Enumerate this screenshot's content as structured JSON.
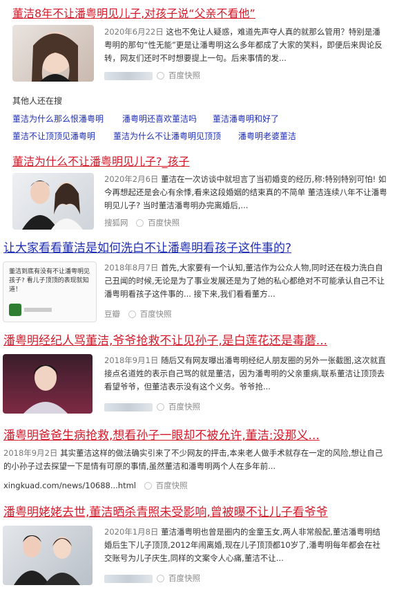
{
  "results": [
    {
      "title": "董洁8年不让潘粤明见儿子,对孩子说“父亲不看他”",
      "date": "2020年6月22日",
      "snippet": "这也不免让人疑惑，难道先声夺人真的就那么管用？特别是潘粤明的那句“性无能”更是让潘粤明这么多年都成了大家的笑料，即便后来舆论反转，网友们还时不时想要提上一句。后来事情的发...",
      "source": "百度快照"
    },
    {
      "title": "董洁为什么不让潘粤明见儿子?_孩子",
      "date": "2020年2月6日",
      "snippet": "董洁在一次访谈中就坦言了当初婚变的经历,称:特别特别可怕! 如今再想起还是会心有余悸,看来这段婚姻的结束真的不简单 董洁连续八年不让潘粤明见儿子? 当时董洁潘粤明办完离婚后,...",
      "site": "搜狐网",
      "source": "百度快照"
    },
    {
      "title": "让大家看看董洁是如何洗白不让潘粤明看孩子这件事的?",
      "thumb_text": "董洁到底有没有不让潘粤明见孩子? 看儿子顶顶的表现就知道！",
      "date": "2018年8月7日",
      "snippet": "首先,大家要有一个认知,董洁作为公众人物,同时还在极力洗白自己丑闻的时候,无论是为了事业发展还是为了她的私心都绝对不可能承认自己不让潘粤明看孩子这件事的... 接下来,我们看看董方...",
      "site": "豆瓣",
      "source": "百度快照"
    },
    {
      "title": "潘粤明经纪人骂董洁,爷爷抢救不让见孙子,是白莲花还是毒蘑...",
      "date": "2018年9月1日",
      "snippet": "随后又有网友曝出潘粤明经纪人朋友圈的另外一张截图,这次就直接点名道姓的表示自己骂的就是董洁，因为潘粤明的父亲重病,联系董洁让顶顶去看望爷爷，但董洁表示没有这个义务。爷爷抢...",
      "source": "百度快照"
    },
    {
      "title": "潘粤明爸爸生病抢救,想看孙子一眼却不被允许,董洁:没那义...",
      "date": "2018年9月2日",
      "snippet": "其实董洁这样的做法确实引来了不少网友的抨击,本来老人做手术就存在一定的风险,想让自己的小孙子过去探望一下是情有可原的事情,虽然董洁和潘粤明两个人在多年前...",
      "url": "xingkuad.com/news/10688...html",
      "source": "百度快照"
    },
    {
      "title": "潘粤明姥姥去世,董洁晒杀青照未受影响,曾被曝不让儿子看爷爷",
      "date": "2020年1月8日",
      "snippet": "董洁潘粤明也曾是圈内的金童玉女,两人非常般配,董洁潘粤明结婚后生下儿子顶顶,2012年闹离婚,现在儿子顶顶都10岁了,潘粤明每年都会在社交账号为儿子庆生,同样的文案令人心痛,董洁不让...",
      "source": "百度快照"
    }
  ],
  "related": {
    "heading": "其他人还在搜",
    "items": [
      "董洁为什么那么恨潘粤明",
      "潘粤明还喜欢董洁吗",
      "董洁潘粤明和好了",
      "董洁不让顶顶见潘粤明",
      "董洁为什么不让潘粤明见顶顶",
      "潘粤明老婆董洁"
    ]
  }
}
